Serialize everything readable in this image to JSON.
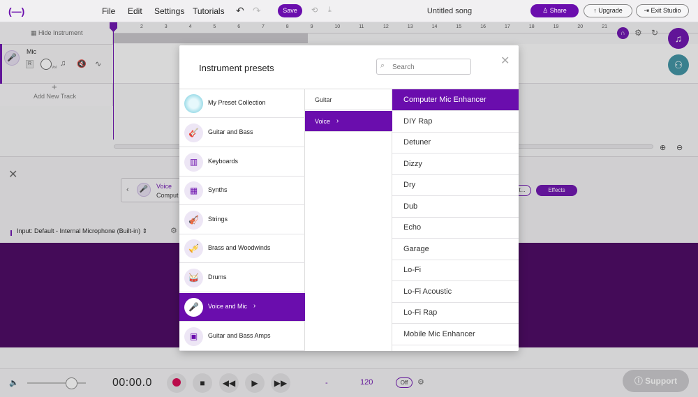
{
  "topbar": {
    "logo": "(—)",
    "menu": [
      "File",
      "Edit",
      "Settings",
      "Tutorials"
    ],
    "save_label": "Save",
    "song_title": "Untitled song",
    "share_label": "Share",
    "upgrade_label": "Upgrade",
    "exit_label": "Exit Studio"
  },
  "tracks": {
    "hide_label": "Hide Instrument",
    "track_name": "Mic",
    "r_label": "R",
    "vol_label": "Vol",
    "add_track": "Add New Track"
  },
  "ruler": [
    "2",
    "3",
    "4",
    "5",
    "6",
    "7",
    "8",
    "9",
    "10",
    "11",
    "12",
    "13",
    "14",
    "15",
    "16",
    "17",
    "18",
    "19",
    "20",
    "21"
  ],
  "lower": {
    "preset_type": "Voice",
    "preset_name": "Comput",
    "tune_label": "t...",
    "effects_label": "Effects",
    "input_label": "Input: Default - Internal Microphone (Built-in)"
  },
  "transport": {
    "time": "00:00.0",
    "key": "-",
    "bpm": "120",
    "metronome": "Off",
    "support": "Support"
  },
  "modal": {
    "title": "Instrument presets",
    "search_placeholder": "Search",
    "categories": [
      {
        "label": "My Preset Collection",
        "icon": "bubble-icon"
      },
      {
        "label": "Guitar and Bass",
        "icon": "guitar-icon"
      },
      {
        "label": "Keyboards",
        "icon": "keyboard-icon"
      },
      {
        "label": "Synths",
        "icon": "synth-icon"
      },
      {
        "label": "Strings",
        "icon": "violin-icon"
      },
      {
        "label": "Brass and Woodwinds",
        "icon": "trumpet-icon"
      },
      {
        "label": "Drums",
        "icon": "drum-icon"
      },
      {
        "label": "Voice and Mic",
        "icon": "mic-icon",
        "active": true
      },
      {
        "label": "Guitar and Bass Amps",
        "icon": "amp-icon"
      }
    ],
    "subcategories": [
      {
        "label": "Guitar"
      },
      {
        "label": "Voice",
        "active": true
      }
    ],
    "presets": [
      {
        "label": "Computer Mic Enhancer",
        "active": true
      },
      {
        "label": "DIY Rap"
      },
      {
        "label": "Detuner"
      },
      {
        "label": "Dizzy"
      },
      {
        "label": "Dry"
      },
      {
        "label": "Dub"
      },
      {
        "label": "Echo"
      },
      {
        "label": "Garage"
      },
      {
        "label": "Lo-Fi"
      },
      {
        "label": "Lo-Fi Acoustic"
      },
      {
        "label": "Lo-Fi Rap"
      },
      {
        "label": "Mobile Mic Enhancer"
      }
    ]
  },
  "colors": {
    "accent": "#6a0dad",
    "dark_panel": "#46005e",
    "record": "#d6004e"
  }
}
